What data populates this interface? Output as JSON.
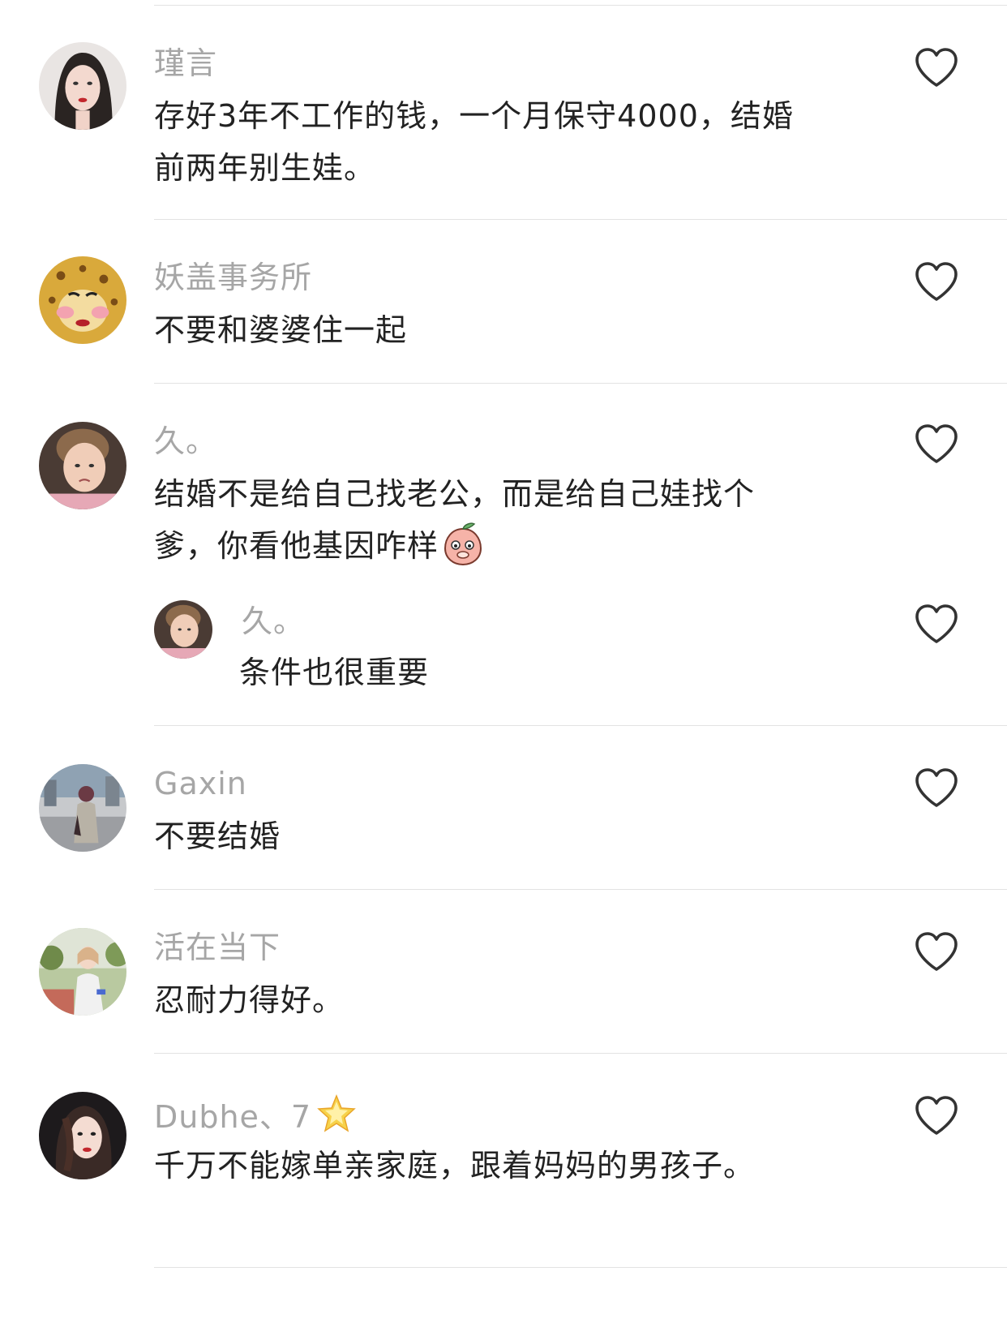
{
  "comments": [
    {
      "username": "瑾言",
      "text_lines": [
        "存好3年不工作的钱，一个月保守4000，结婚",
        "前两年别生娃。"
      ]
    },
    {
      "username": "妖盖事务所",
      "text_lines": [
        "不要和婆婆住一起"
      ]
    },
    {
      "username": "久。",
      "text_lines": [
        "结婚不是给自己找老公，而是给自己娃找个",
        "爹，你看他基因咋样"
      ],
      "emoji": "peach-face-icon",
      "reply": {
        "username": "久。",
        "text": "条件也很重要"
      }
    },
    {
      "username": "Gaxin",
      "text_lines": [
        "不要结婚"
      ]
    },
    {
      "username": "活在当下",
      "text_lines": [
        "忍耐力得好。"
      ]
    },
    {
      "username": "Dubhe、7",
      "username_badge": "star-icon",
      "text_lines": [
        "千万不能嫁单亲家庭，跟着妈妈的男孩子。"
      ]
    }
  ],
  "icons": {
    "like": "heart-outline-icon"
  },
  "colors": {
    "username": "#a6a6a6",
    "comment_text": "#222222",
    "divider": "#e3e3e3",
    "heart_stroke": "#333333"
  }
}
